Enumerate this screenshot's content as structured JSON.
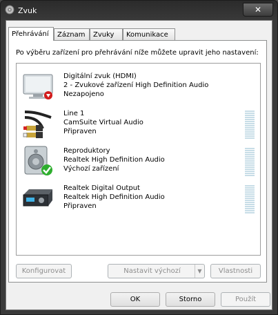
{
  "window": {
    "title": "Zvuk",
    "close_glyph": "✕"
  },
  "tabs": [
    {
      "label": "Přehrávání",
      "active": true
    },
    {
      "label": "Záznam",
      "active": false
    },
    {
      "label": "Zvuky",
      "active": false
    },
    {
      "label": "Komunikace",
      "active": false
    }
  ],
  "instruction": "Po výběru zařízení pro přehrávání níže můžete upravit jeho nastavení:",
  "devices": [
    {
      "icon": "monitor-speaker-icon",
      "name": "Digitální zvuk (HDMI)",
      "description": "2 - Zvukové zařízení High Definition Audio",
      "status": "Nezapojeno",
      "status_badge": "red-down-arrow"
    },
    {
      "icon": "rca-cable-icon",
      "name": "Line 1",
      "description": "CamSuite Virtual Audio",
      "status": "Připraven"
    },
    {
      "icon": "speaker-icon",
      "name": "Reproduktory",
      "description": "Realtek High Definition Audio",
      "status": "Výchozí zařízení",
      "status_badge": "green-check"
    },
    {
      "icon": "digital-output-device-icon",
      "name": "Realtek Digital Output",
      "description": "Realtek High Definition Audio",
      "status": "Připraven"
    }
  ],
  "panel_buttons": {
    "configure": "Konfigurovat",
    "set_default": "Nastavit výchozí",
    "properties": "Vlastnosti"
  },
  "dialog_buttons": {
    "ok": "OK",
    "cancel": "Storno",
    "apply": "Použít"
  },
  "colors": {
    "meter": "#c7dde7",
    "badge_green": "#2eae2e",
    "badge_red": "#d21c1c"
  }
}
